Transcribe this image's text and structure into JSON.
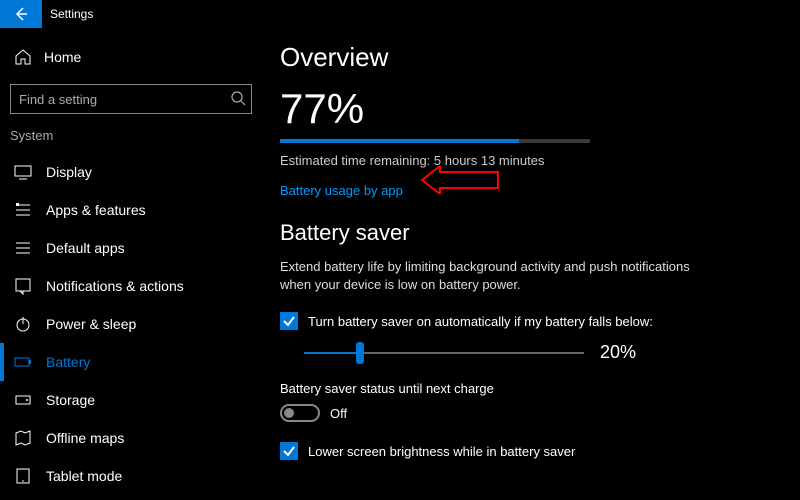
{
  "titlebar": {
    "title": "Settings"
  },
  "sidebar": {
    "home": "Home",
    "search_placeholder": "Find a setting",
    "section": "System",
    "items": [
      {
        "label": "Display"
      },
      {
        "label": "Apps & features"
      },
      {
        "label": "Default apps"
      },
      {
        "label": "Notifications & actions"
      },
      {
        "label": "Power & sleep"
      },
      {
        "label": "Battery"
      },
      {
        "label": "Storage"
      },
      {
        "label": "Offline maps"
      },
      {
        "label": "Tablet mode"
      }
    ]
  },
  "main": {
    "heading": "Overview",
    "percent_text": "77%",
    "percent_value": 77,
    "estimate": "Estimated time remaining: 5 hours 13 minutes",
    "link": "Battery usage by app",
    "saver_heading": "Battery saver",
    "saver_desc": "Extend battery life by limiting background activity and push notifications when your device is low on battery power.",
    "auto_label": "Turn battery saver on automatically if my battery falls below:",
    "slider_value": 20,
    "slider_label": "20%",
    "status_label": "Battery saver status until next charge",
    "toggle_state": "Off",
    "lower_brightness_label": "Lower screen brightness while in battery saver"
  },
  "colors": {
    "accent": "#0078d7",
    "link": "#0099ff"
  }
}
